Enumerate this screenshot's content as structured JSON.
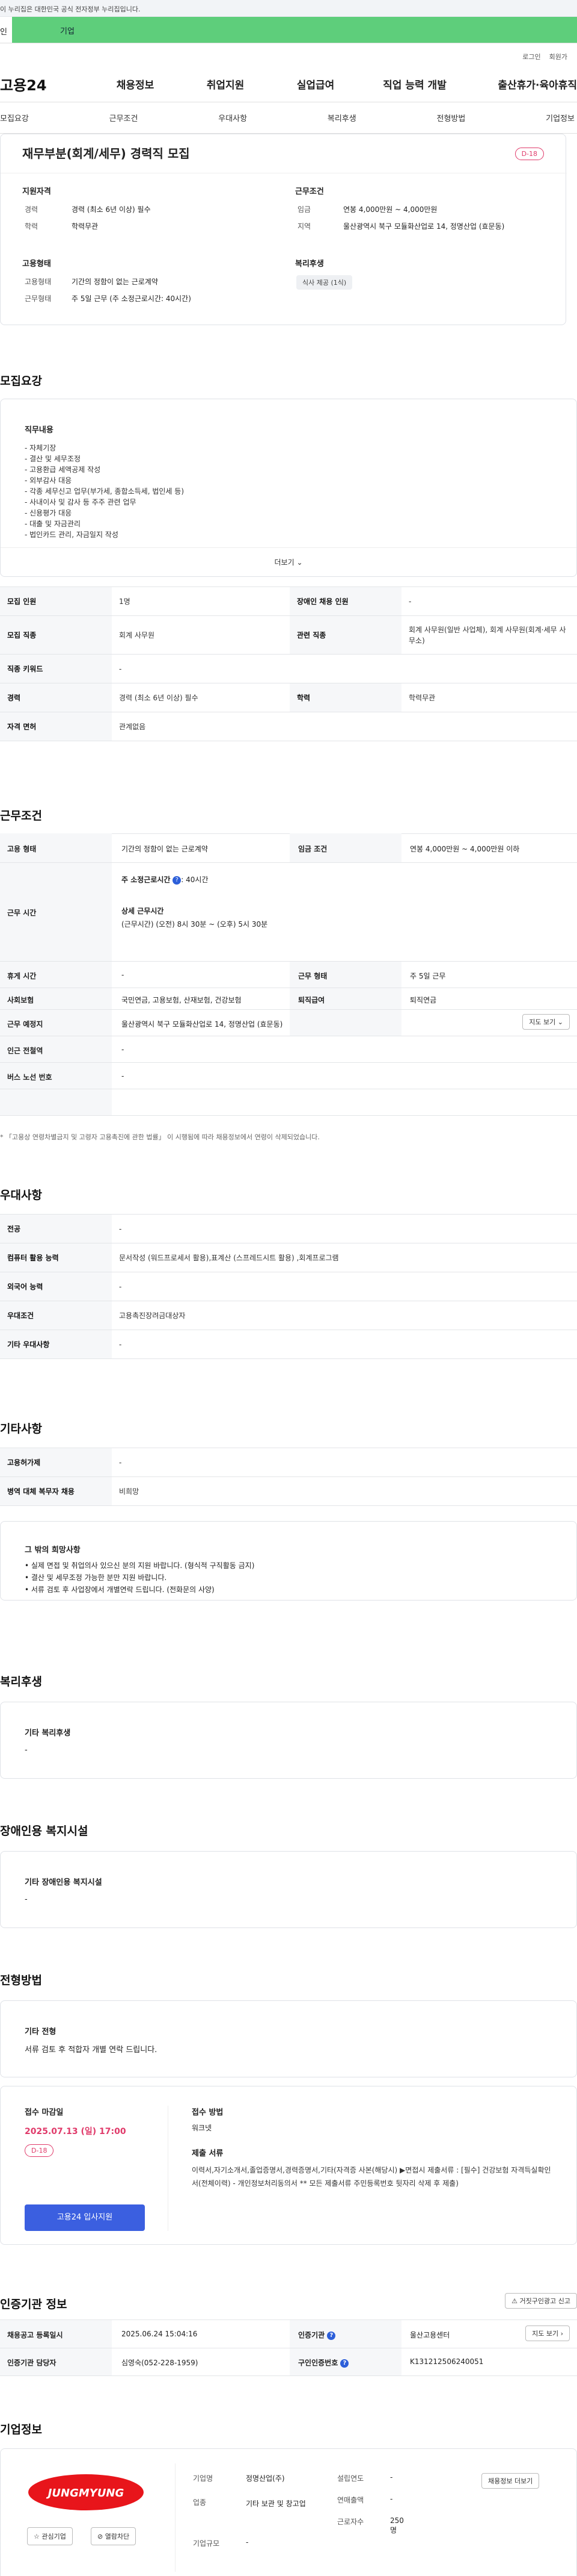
{
  "gov_banner": "이 누리집은 대한민국 공식 전자정부 누리집입니다.",
  "tabs": {
    "tab1": "인",
    "tab2": "기업"
  },
  "util": {
    "login": "로그인",
    "join": "회원가"
  },
  "gnb": {
    "logo": "고용24",
    "menu": [
      "채용정보",
      "취업지원",
      "실업급여",
      "직업 능력 개발",
      "출산휴가·육아휴직"
    ]
  },
  "snb": [
    "모집요강",
    "근무조건",
    "우대사항",
    "복리후생",
    "전형방법",
    "기업정보"
  ],
  "job": {
    "title": "재무부분(회계/세무) 경력직 모집",
    "dday": "D-18"
  },
  "summary": {
    "qual_title": "지원자격",
    "career_label": "경력",
    "career": "경력 (최소 6년 이상) 필수",
    "edu_label": "학력",
    "edu": "학력무관",
    "form_title": "고용형태",
    "type_label": "고용형태",
    "type": "기간의 정함이 없는 근로계약",
    "hours_label": "근무형태",
    "hours": "주 5일 근무 (주 소정근로시간: 40시간)",
    "cond_title": "근무조건",
    "wage_label": "임금",
    "wage": "연봉 4,000만원 ~ 4,000만원",
    "region_label": "지역",
    "region": "울산광역시 북구 모듈화산업로 14, 정명산업 (효문동)",
    "welfare_title": "복리후생",
    "welfare_tag": "식사 제공 (1식)"
  },
  "recruit": {
    "title": "모집요강",
    "duty_title": "직무내용",
    "duties": [
      "- 자체기장",
      "- 결산 및 세무조정",
      "- 고용환급 세액공제 작성",
      "- 외부감사 대응",
      "- 각종 세무신고 업무(부가세, 종합소득세, 법인세 등)",
      "- 사내이사 및 감사 등 주주 관련 업무",
      "- 신용평가 대응",
      "- 대출 및 자금관리",
      "- 법인카드 관리, 자금일지 작성"
    ],
    "more": "더보기",
    "rows": [
      [
        {
          "k": "모집 인원",
          "v": "1명"
        },
        {
          "k": "장애인 채용 인원",
          "v": "-"
        }
      ],
      [
        {
          "k": "모집 직종",
          "v": "회계 사무원"
        },
        {
          "k": "관련 직종",
          "v": "회계 사무원(일반 사업체), 회계 사무원(회계·세무 사무소)"
        }
      ],
      [
        {
          "k": "직종 키워드",
          "v": "-"
        }
      ],
      [
        {
          "k": "경력",
          "v": "경력 (최소 6년 이상) 필수"
        },
        {
          "k": "학력",
          "v": "학력무관"
        }
      ],
      [
        {
          "k": "자격 면허",
          "v": "관계없음"
        }
      ]
    ]
  },
  "conditions": {
    "title": "근무조건",
    "type_k": "고용 형태",
    "type_v": "기간의 정함이 없는 근로계약",
    "wage_k": "임금 조건",
    "wage_v": "연봉 4,000만원 ~ 4,000만원 이하",
    "time_k": "근무 시간",
    "weekly": "주 소정근로시간",
    "weekly_v": ": 40시간",
    "detail_title": "상세 근무시간",
    "detail": "(근무시간) (오전) 8시 30분 ~ (오후) 5시 30분",
    "rest_k": "휴게 시간",
    "rest_v": "-",
    "form_k": "근무 형태",
    "form_v": "주 5일 근무",
    "ins_k": "사회보험",
    "ins_v": "국민연금, 고용보험, 산재보험, 건강보험",
    "sev_k": "퇴직급여",
    "sev_v": "퇴직연금",
    "place_k": "근무 예정지",
    "place_v": "울산광역시 북구 모듈화산업로 14, 정명산업 (효문동)",
    "map_btn": "지도 보기",
    "station_k": "인근 전철역",
    "station_v": "-",
    "bus_k": "버스 노선 번호",
    "bus_v": "-",
    "note": "* 「고용상 연령차별금지 및 고령자 고용촉진에 관한 법률」 이 시행됨에 따라 채용정보에서 연령이 삭제되었습니다."
  },
  "pref": {
    "title": "우대사항",
    "rows": [
      {
        "k": "전공",
        "v": "-"
      },
      {
        "k": "컴퓨터 활용 능력",
        "v": "문서작성 (워드프로세서 활용),표계산 (스프레드시트 활용) ,회계프로그램"
      },
      {
        "k": "외국어 능력",
        "v": "-"
      },
      {
        "k": "우대조건",
        "v": "고용촉진장려금대상자"
      },
      {
        "k": "기타 우대사항",
        "v": "-"
      }
    ]
  },
  "etc": {
    "title": "기타사항",
    "rows": [
      {
        "k": "고용허가제",
        "v": "-"
      },
      {
        "k": "병역 대체 복무자 채용",
        "v": "비희망"
      }
    ],
    "wish_title": "그 밖의 희망사항",
    "wish": [
      "• 실제 면접 및 취업의사 있으신 분의 지원 바랍니다. (형식적 구직활동 금지)",
      "• 결산 및 세무조정 가능한 분만 지원 바랍니다.",
      "• 서류 검토 후 사업장에서 개별연락 드립니다. (전화문의 사양)"
    ]
  },
  "benefit": {
    "title": "복리후생",
    "box_title": "기타 복리후생",
    "box_val": "-"
  },
  "disab": {
    "title": "장애인용 복지시설",
    "box_title": "기타 장애인용 복지시설",
    "box_val": "-"
  },
  "process": {
    "title": "전형방법",
    "etc_title": "기타 전형",
    "etc_val": "서류 검토 후 적합자 개별 연락 드립니다.",
    "deadline_title": "접수 마감일",
    "deadline": "2025.07.13 (일) 17:00",
    "dday": "D-18",
    "apply_btn": "고용24 입사지원",
    "method_title": "접수 방법",
    "method": "워크넷",
    "docs_title": "제출 서류",
    "docs": "이력서,자기소개서,졸업증명서,경력증명서,기타(자격증 사본(해당시) ▶면접시 제출서류 : [필수] 건강보험 자격득실확인서(전체이력) - 개인정보처리동의서 ** 모든 제출서류 주민등록번호 뒷자리 삭제 후 제출)"
  },
  "agency": {
    "title": "인증기관 정보",
    "report_btn": "거짓구인광고 신고",
    "reg_k": "채용공고 등록일시",
    "reg_v": "2025.06.24 15:04:16",
    "inst_k": "인증기관",
    "inst_v": "울산고용센터",
    "map_btn": "지도 보기",
    "mgr_k": "인증기관 담당자",
    "mgr_v": "심영숙(052-228-1959)",
    "no_k": "구인인증번호",
    "no_v": "K131212506240051"
  },
  "company": {
    "title": "기업정보",
    "logo_text": "JUNGMYUNG",
    "fav_btn": "관심기업",
    "hire_btn": "열람차단",
    "info_btn": "채용정보 더보기",
    "biz_k": "기업명",
    "biz_v": "정명산업(주)",
    "ind_k": "업종",
    "ind_v": "기타 보관 및 창고업",
    "size_k": "기업규모",
    "size_v": "-",
    "est_k": "설립연도",
    "est_v": "-",
    "sales_k": "연매출액",
    "sales_v": "-",
    "emp_k": "근로자수",
    "emp_v": "250명"
  },
  "colors": {
    "accent_green": "#5ece7b",
    "dday_pink": "#e03a6a",
    "apply_blue": "#3b5fe0"
  }
}
